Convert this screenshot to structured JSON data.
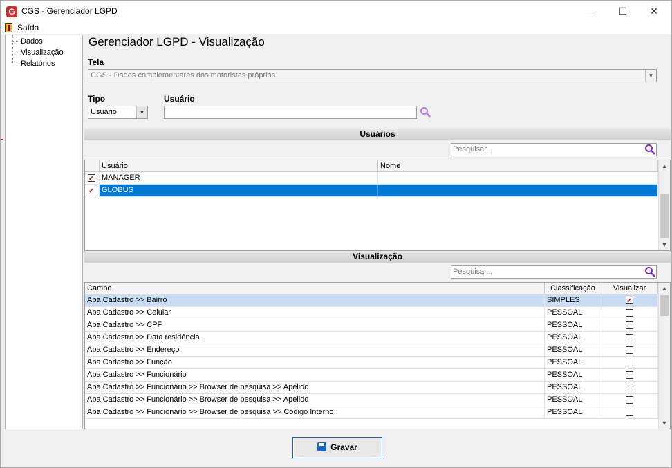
{
  "window": {
    "title": "CGS - Gerenciador LGPD",
    "minimize": "—",
    "maximize": "☐",
    "close": "✕"
  },
  "app_icon_letter": "G",
  "menu": {
    "exit_label": "Saída"
  },
  "tree": {
    "items": [
      {
        "label": "Dados"
      },
      {
        "label": "Visualização"
      },
      {
        "label": "Relatórios"
      }
    ]
  },
  "page": {
    "title": "Gerenciador LGPD - Visualização",
    "tela_label": "Tela",
    "tela_value": "CGS - Dados complementares dos motoristas próprios",
    "tipo_label": "Tipo",
    "tipo_value": "Usuário",
    "usuario_label": "Usuário",
    "usuario_value": ""
  },
  "users_section": {
    "title": "Usuários",
    "search_placeholder": "Pesquisar...",
    "columns": [
      "Usuário",
      "Nome"
    ],
    "rows": [
      {
        "checked": true,
        "usuario": "MANAGER",
        "nome": ""
      },
      {
        "checked": true,
        "usuario": "GLOBUS",
        "nome": ""
      }
    ]
  },
  "view_section": {
    "title": "Visualização",
    "search_placeholder": "Pesquisar...",
    "columns": [
      "Campo",
      "Classificação",
      "Visualizar"
    ],
    "rows": [
      {
        "campo": "Aba Cadastro >> Bairro",
        "classificacao": "SIMPLES",
        "visualizar": true
      },
      {
        "campo": "Aba Cadastro >> Celular",
        "classificacao": "PESSOAL",
        "visualizar": false
      },
      {
        "campo": "Aba Cadastro >> CPF",
        "classificacao": "PESSOAL",
        "visualizar": false
      },
      {
        "campo": "Aba Cadastro >> Data residência",
        "classificacao": "PESSOAL",
        "visualizar": false
      },
      {
        "campo": "Aba Cadastro >> Endereço",
        "classificacao": "PESSOAL",
        "visualizar": false
      },
      {
        "campo": "Aba Cadastro >> Função",
        "classificacao": "PESSOAL",
        "visualizar": false
      },
      {
        "campo": "Aba Cadastro >> Funcionário",
        "classificacao": "PESSOAL",
        "visualizar": false
      },
      {
        "campo": "Aba Cadastro >> Funcionário >> Browser de pesquisa >> Apelido",
        "classificacao": "PESSOAL",
        "visualizar": false
      },
      {
        "campo": "Aba Cadastro >> Funcionário >> Browser de pesquisa >> Apelido",
        "classificacao": "PESSOAL",
        "visualizar": false
      },
      {
        "campo": "Aba Cadastro >> Funcionário >> Browser de pesquisa >> Código Interno",
        "classificacao": "PESSOAL",
        "visualizar": false
      }
    ]
  },
  "footer": {
    "save_label": "Gravar"
  },
  "colors": {
    "selection": "#0078d7",
    "selection_light": "#c8dcf4",
    "search_icon": "#7b2fbf",
    "app_icon": "#d42b2b"
  }
}
